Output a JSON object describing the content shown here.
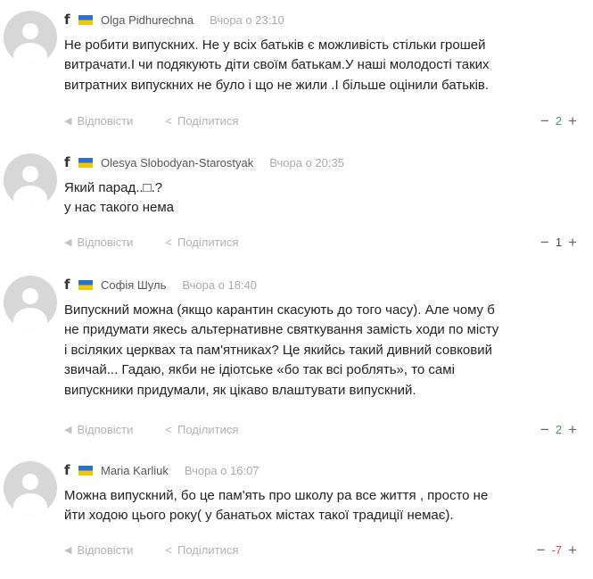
{
  "actions": {
    "reply_label": "Відповісти",
    "share_label": "Поділитися",
    "minus": "−",
    "plus": "+"
  },
  "colors": {
    "positive_score": "#3a9d5d",
    "negative_score": "#d84a4a",
    "flag_blue": "#2b6fd1",
    "flag_yellow": "#f2c800"
  },
  "icons": {
    "source": "facebook-icon",
    "flag": "ukraine-flag-icon",
    "reply": "reply-arrow-icon",
    "share": "share-icon"
  },
  "comments": [
    {
      "source": "f",
      "author": "Olga Pidhurechna",
      "date": "Вчора о 23:10",
      "lines": [
        "Не робити випускних. Не у всіх батьків є можливість стільки грошей",
        "витрачати.І чи подякують діти своїм батькам.У наші молодості таких",
        "витратних випускних не було і що не жили .І більше оцінили батьків."
      ],
      "score": "2",
      "score_sign": "positive"
    },
    {
      "source": "f",
      "author": "Olesya Slobodyan-Starostyak",
      "date": "Вчора о 20:35",
      "lines": [
        "Який парад..□.?",
        "у нас такого нема"
      ],
      "score": "1",
      "score_sign": "neutral"
    },
    {
      "source": "f",
      "author": "Софія Шуль",
      "date": "Вчора о 18:40",
      "lines": [
        "Випускний можна (якщо карантин скасують до того часу). Але чому б",
        "не придумати якесь альтернативне святкування замість ходи по місту",
        "і всіляких церквах та пам'ятниках? Це якийсь такий дивний совковий",
        "звичай... Гадаю, якби не ідіотське «бо так всі роблять», то самі",
        "випускники придумали, як цікаво влаштувати випускний."
      ],
      "score": "2",
      "score_sign": "positive"
    },
    {
      "source": "f",
      "author": "Maria Karliuk",
      "date": "Вчора о 16:07",
      "lines": [
        "Можна випускний, бо це пам'ять про школу ра все життя , просто не",
        "йти ходою цього року( у банатьох містах такої традиції немає)."
      ],
      "score": "-7",
      "score_sign": "negative"
    }
  ]
}
